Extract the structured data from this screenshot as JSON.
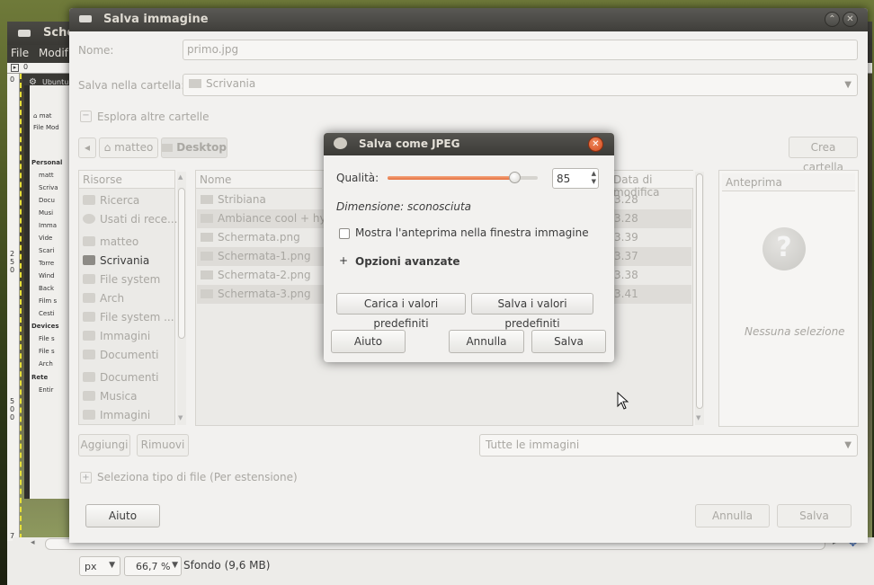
{
  "gimp": {
    "title": "Sche",
    "menu": [
      "File",
      "Modif"
    ],
    "ruler_zero": "0",
    "ruler_left": [
      "0",
      "2",
      "5",
      "0",
      "5",
      "0",
      "0",
      "7"
    ],
    "inner_window": {
      "title": "Ubuntu",
      "label_mat": "mat",
      "menu": [
        "File",
        "Mod"
      ],
      "sections": [
        "Personal",
        "Devices",
        "Rete"
      ],
      "items": [
        "matt",
        "Scriva",
        "Docu",
        "Musi",
        "Imma",
        "Vide",
        "Scari",
        "Torre",
        "Wind",
        "Back",
        "Film s",
        "Cesti",
        "File s",
        "File s",
        "Arch",
        "Entir"
      ]
    },
    "status": {
      "unit": "px",
      "zoom": "66,7 %",
      "info": "Sfondo (9,6 MB)"
    }
  },
  "save_dialog": {
    "title": "Salva immagine",
    "name_label": "Nome:",
    "name_value": "primo.jpg",
    "folder_label": "Salva nella cartella:",
    "folder_value": "Scrivania",
    "browse_label": "Esplora altre cartelle",
    "path": [
      "matteo",
      "Desktop"
    ],
    "create_folder": "Crea cartella",
    "places_header": "Risorse",
    "places": [
      "Ricerca",
      "Usati di rece...",
      "matteo",
      "Scrivania",
      "File system",
      "Arch",
      "File system ...",
      "Immagini",
      "Documenti",
      "Documenti",
      "Musica",
      "Immagini"
    ],
    "selected_place": "Scrivania",
    "add_button": "Aggiungi",
    "remove_button": "Rimuovi",
    "files_header_name": "Nome",
    "files_header_date": "Data di modifica",
    "files": [
      {
        "name": "Stribiana",
        "date": "3.28"
      },
      {
        "name": "Ambiance cool + hydr",
        "date": "3.28"
      },
      {
        "name": "Schermata.png",
        "date": "3.39"
      },
      {
        "name": "Schermata-1.png",
        "date": "3.37"
      },
      {
        "name": "Schermata-2.png",
        "date": "3.38"
      },
      {
        "name": "Schermata-3.png",
        "date": "3.41"
      }
    ],
    "preview_header": "Anteprima",
    "preview_empty": "Nessuna selezione",
    "filter": "Tutte le immagini",
    "file_type_label": "Seleziona tipo di file (Per estensione)",
    "help_button": "Aiuto",
    "cancel_button": "Annulla",
    "save_button": "Salva"
  },
  "jpeg_dialog": {
    "title": "Salva come JPEG",
    "quality_label": "Qualità:",
    "quality_value": "85",
    "quality_max": 100,
    "size_label": "Dimensione: sconosciuta",
    "show_preview_label": "Mostra l'anteprima nella finestra immagine",
    "show_preview_checked": false,
    "advanced_label": "Opzioni avanzate",
    "load_defaults": "Carica i valori predefiniti",
    "save_defaults": "Salva i valori predefiniti",
    "help_button": "Aiuto",
    "cancel_button": "Annulla",
    "save_button": "Salva"
  },
  "colors": {
    "accent": "#e5703f",
    "titlebar": "#3c3b37"
  }
}
